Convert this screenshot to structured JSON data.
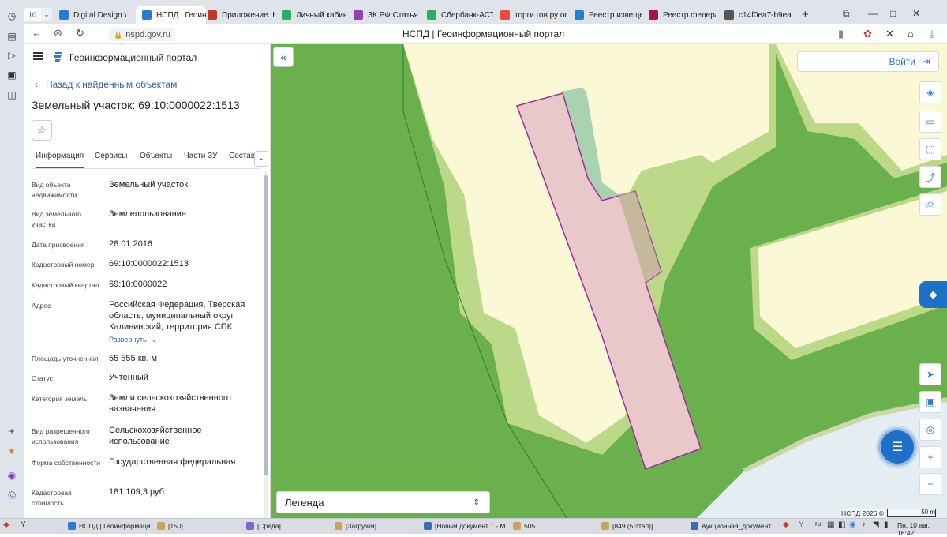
{
  "browser": {
    "tab_counter": "10",
    "tabs": [
      {
        "label": "Digital Design We",
        "color": "#2b7bd6"
      },
      {
        "label": "НСПД | Геоин",
        "color": "#2b7bd6",
        "active": true
      },
      {
        "label": "Приложение. Кла",
        "color": "#c0392b"
      },
      {
        "label": "Личный кабинет",
        "color": "#27ae60"
      },
      {
        "label": "ЗК РФ Статья 39",
        "color": "#8e44ad"
      },
      {
        "label": "Сбербанк-АСТ",
        "color": "#27ae60"
      },
      {
        "label": "торги гов ру офи",
        "color": "#e74c3c"
      },
      {
        "label": "Реестр извещен",
        "color": "#2b7bd6"
      },
      {
        "label": "Реестр федерал",
        "color": "#a8124a"
      },
      {
        "label": "c14f0ea7-b9ea-4",
        "color": "#555555"
      }
    ],
    "tab_close": "✕",
    "new_tab": "+",
    "url": "nspd.gov.ru",
    "page_title": "НСПД | Геоинформационный портал"
  },
  "panel": {
    "portal_name": "Геоинформационный портал",
    "back_link": "Назад к найденным объектам",
    "object_title": "Земельный участок: 69:10:0000022:1513",
    "tabs": [
      "Информация",
      "Сервисы",
      "Объекты",
      "Части ЗУ",
      "Состав"
    ],
    "properties": [
      {
        "label": "Вид объекта недвижимости",
        "value": "Земельный участок"
      },
      {
        "label": "Вид земельного участка",
        "value": "Землепользование"
      },
      {
        "label": "Дата присвоения",
        "value": "28.01.2016"
      },
      {
        "label": "Кадастровый номер",
        "value": "69:10:0000022:1513"
      },
      {
        "label": "Кадастровый квартал",
        "value": "69:10:0000022"
      },
      {
        "label": "Адрес",
        "value": "Российская Федерация, Тверская область, муниципальный округ Калининский, территория СПК"
      },
      {
        "label": "Площадь уточненная",
        "value": "55 555 кв. м"
      },
      {
        "label": "Статус",
        "value": "Учтенный"
      },
      {
        "label": "Категория земель",
        "value": "Земли сельскохозяйственного назначения"
      },
      {
        "label": "Вид разрешенного использования",
        "value": "Сельскохозяйственное использование"
      },
      {
        "label": "Форма собственности",
        "value": "Государственная федеральная"
      },
      {
        "label": "Кадастровая стоимость",
        "value": "181 109,3 руб."
      }
    ],
    "expand_label": "Развернуть"
  },
  "map": {
    "login_label": "Войти",
    "legend_label": "Легенда",
    "copyright": "НСПД 2026 ©",
    "scale_label": "50 m",
    "colors": {
      "green": "#6ab04c",
      "yellow": "#fbf8d6",
      "parcel": "#e8c8c9",
      "parcel_border": "#9b2fa0",
      "water": "#e4eef2"
    }
  },
  "taskbar": {
    "items": [
      {
        "label": "НСПД | Геоинформаци...",
        "color": "#2b7bd6"
      },
      {
        "label": "[150]",
        "color": "#c9a55b"
      },
      {
        "label": "[Среда]",
        "color": "#7b68c8"
      },
      {
        "label": "[Загрузки]",
        "color": "#c9a55b"
      },
      {
        "label": "[Новый документ 1 - М...",
        "color": "#3b6bb0"
      },
      {
        "label": "505",
        "color": "#c9a55b"
      },
      {
        "label": "[849 (5 этап)]",
        "color": "#c9a55b"
      },
      {
        "label": "Аукционная_документ...",
        "color": "#3b6bb0"
      }
    ],
    "lang": "ru",
    "clock": "Пн, 10 авг, 16:42"
  }
}
